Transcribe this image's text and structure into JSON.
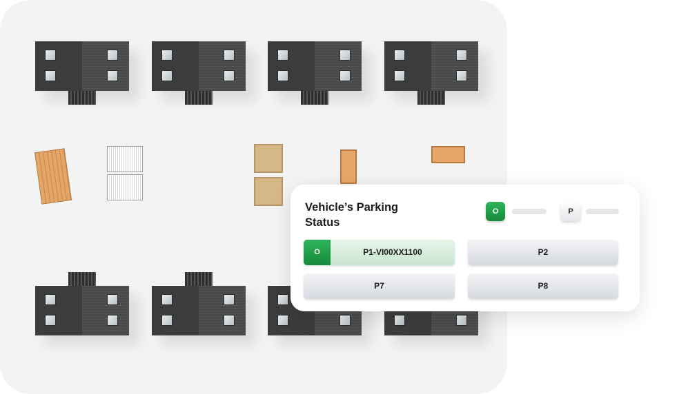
{
  "card": {
    "title": "Vehicle’s Parking Status",
    "legend": {
      "occupied_badge": "O",
      "parked_badge": "P"
    },
    "slots": [
      {
        "label": "P1-VI00XX1100",
        "status_badge": "O",
        "occupied": true
      },
      {
        "label": "P2",
        "occupied": false
      },
      {
        "label": "P7",
        "occupied": false
      },
      {
        "label": "P8",
        "occupied": false
      }
    ]
  },
  "colors": {
    "occupied_green": "#1f9e48",
    "occupied_slot_bg": "#d8eedd",
    "scene_bg": "#f3f3f3",
    "building": "#404040"
  },
  "icons": [
    "building-icon",
    "crate-icon",
    "pallet-icon",
    "vent-icon"
  ]
}
